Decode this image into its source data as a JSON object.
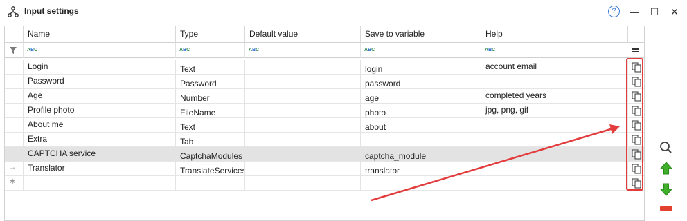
{
  "window": {
    "title": "Input settings",
    "help_icon": "help-circle-icon",
    "help_label": "?",
    "minimize_label": "—",
    "maximize_label": "☐",
    "close_label": "✕"
  },
  "columns": [
    "Name",
    "Type",
    "Default value",
    "Save to variable",
    "Help"
  ],
  "rows": [
    {
      "name": "Login",
      "type": "Text",
      "default": "",
      "variable": "login",
      "help": "account email",
      "selected": false,
      "indicator": ""
    },
    {
      "name": "Password",
      "type": "Password",
      "default": "",
      "variable": "password",
      "help": "",
      "selected": false,
      "indicator": ""
    },
    {
      "name": "Age",
      "type": "Number",
      "default": "",
      "variable": "age",
      "help": "completed years",
      "selected": false,
      "indicator": ""
    },
    {
      "name": "Profile photo",
      "type": "FileName",
      "default": "",
      "variable": "photo",
      "help": "jpg, png, gif",
      "selected": false,
      "indicator": ""
    },
    {
      "name": "About me",
      "type": "Text",
      "default": "",
      "variable": "about",
      "help": "",
      "selected": false,
      "indicator": ""
    },
    {
      "name": "Extra",
      "type": "Tab",
      "default": "",
      "variable": "",
      "help": "",
      "selected": false,
      "indicator": ""
    },
    {
      "name": "CAPTCHA service",
      "type": "CaptchaModules",
      "default": "",
      "variable": "captcha_module",
      "help": "",
      "selected": true,
      "indicator": ""
    },
    {
      "name": "Translator",
      "type": "TranslateServices",
      "default": "",
      "variable": "translator",
      "help": "",
      "selected": false,
      "indicator": "→"
    },
    {
      "name": "",
      "type": "",
      "default": "",
      "variable": "",
      "help": "",
      "selected": false,
      "indicator": "✱"
    }
  ],
  "side_buttons": [
    {
      "name": "search-button",
      "icon": "magnifier-icon"
    },
    {
      "name": "move-up-button",
      "icon": "green-arrow-up-icon"
    },
    {
      "name": "move-down-button",
      "icon": "green-arrow-down-icon"
    },
    {
      "name": "remove-button",
      "icon": "red-minus-icon"
    }
  ],
  "colors": {
    "annotation_red": "#e23c3c",
    "selected_row": "#e3e3e3",
    "arrow_green": "#3fae2a",
    "remove_red": "#e2412f"
  }
}
